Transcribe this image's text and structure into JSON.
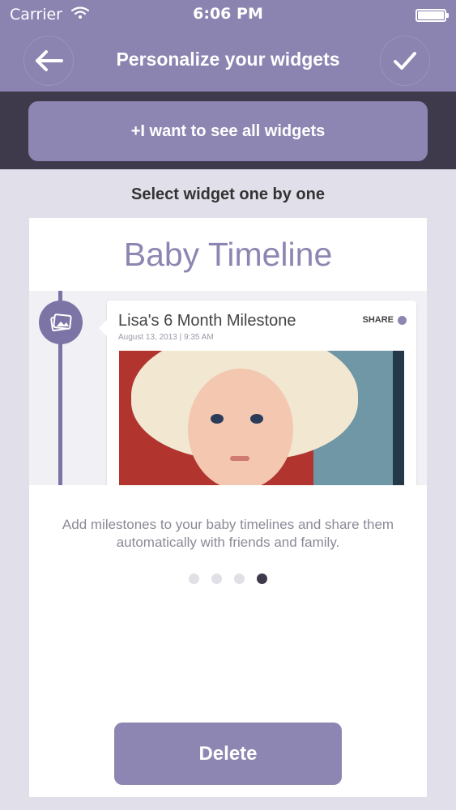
{
  "status_bar": {
    "carrier": "Carrier",
    "time": "6:06 PM"
  },
  "nav": {
    "title": "Personalize your widgets",
    "back_icon": "arrow-left-icon",
    "done_icon": "checkmark-icon"
  },
  "see_all_button": {
    "label": "+I want to see all widgets"
  },
  "subtitle": "Select widget one by one",
  "widget": {
    "title": "Baby Timeline",
    "preview": {
      "post_title": "Lisa's 6 Month Milestone",
      "post_date": "August 13, 2013 | 9:35 AM",
      "share_label": "SHARE",
      "node_icon": "photos-icon"
    },
    "description": "Add milestones to your baby timelines and share them automatically with friends and family."
  },
  "pagination": {
    "total": 4,
    "active_index": 3
  },
  "delete_button": {
    "label": "Delete"
  },
  "colors": {
    "header": "#8b83b0",
    "band": "#3e3a4c",
    "accent": "#8d86b2",
    "background": "#e1dfea"
  }
}
